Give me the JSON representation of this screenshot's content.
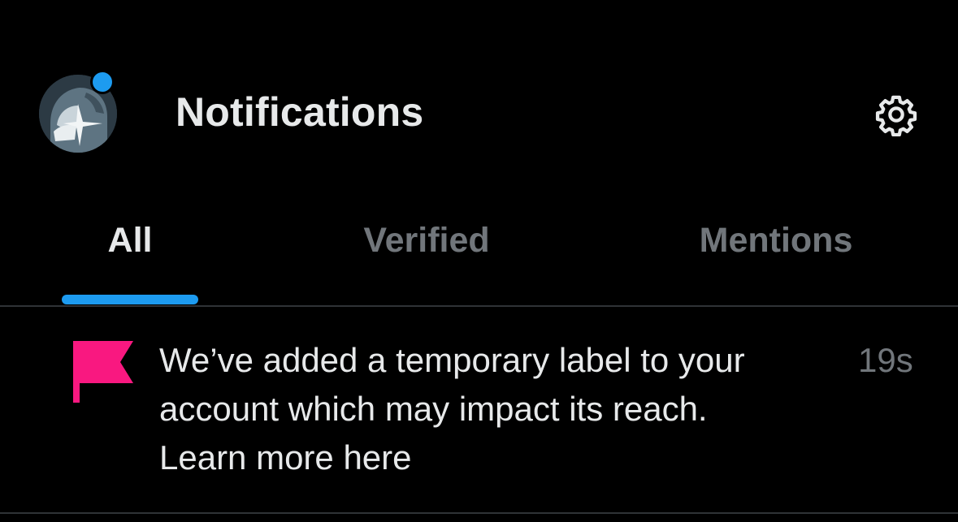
{
  "header": {
    "title": "Notifications",
    "avatar_icon": "avatar-image",
    "avatar_status_color": "#1d9bf0",
    "settings_icon": "gear-icon"
  },
  "tabs": [
    {
      "label": "All",
      "selected": true
    },
    {
      "label": "Verified",
      "selected": false
    },
    {
      "label": "Mentions",
      "selected": false
    }
  ],
  "notifications": [
    {
      "icon": "flag-icon",
      "icon_color": "#f91880",
      "lines": [
        "We’ve added a temporary label to your",
        "account which may impact its reach.",
        "Learn more here"
      ],
      "time": "19s"
    }
  ],
  "colors": {
    "background": "#000000",
    "accent": "#1d9bf0",
    "text_primary": "#e7e9ea",
    "text_secondary": "#71767b",
    "divider": "#2f3336"
  }
}
